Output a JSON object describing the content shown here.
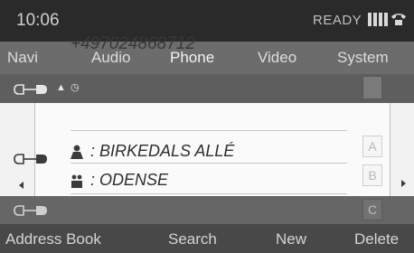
{
  "status": {
    "time": "10:06",
    "ready": "READY"
  },
  "nav": {
    "navi": "Navi",
    "audio": "Audio",
    "phone": "Phone",
    "video": "Video",
    "system": "System"
  },
  "entry": {
    "number": "+497024868712",
    "street": ": BIRKEDALS ALLÉ",
    "city": ": ODENSE"
  },
  "alphabet": [
    "A",
    "B",
    "C"
  ],
  "softkeys": {
    "address_book": "Address Book",
    "search": "Search",
    "new": "New",
    "delete": "Delete"
  },
  "colors": {
    "status_bg": "#2a2a2a",
    "nav_bg": "#6c6c6c",
    "content_bg": "#f2f2f2",
    "softkey_bg": "#484848"
  },
  "icons": [
    "connector-icon",
    "person-icon",
    "company-icon",
    "signal-icon",
    "phone-icon"
  ]
}
